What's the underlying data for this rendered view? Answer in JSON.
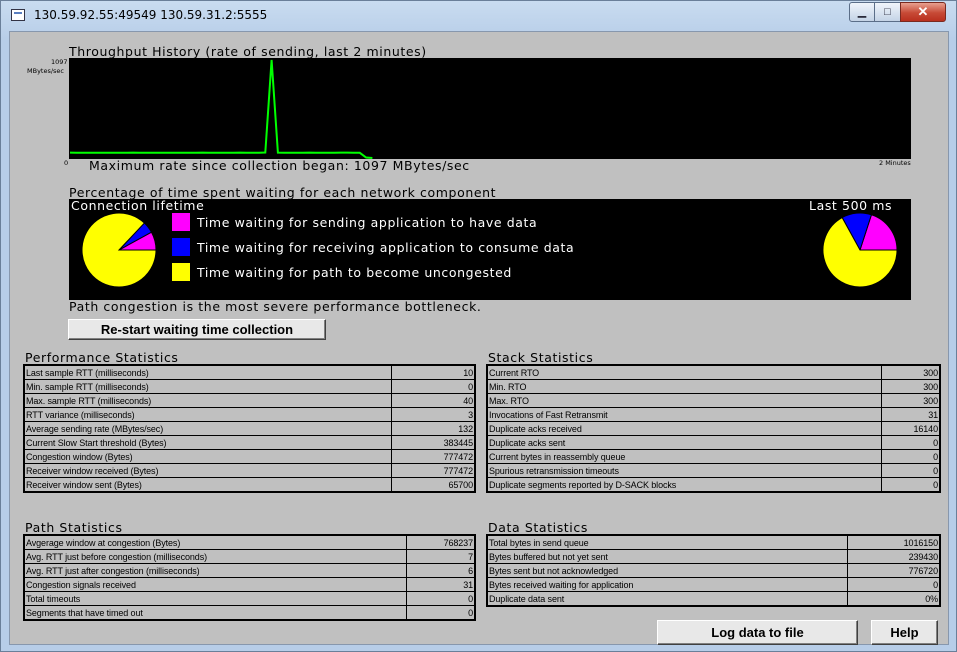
{
  "window": {
    "title": "130.59.92.55:49549 130.59.31.2:5555",
    "minimize_glyph": "▁",
    "maximize_glyph": "□",
    "close_glyph": "✕"
  },
  "throughput": {
    "heading": "Throughput History (rate of sending, last 2 minutes)",
    "y_max_label": "1097",
    "y_unit_label": "MBytes/sec",
    "x_start_label": "0",
    "x_end_label": "2 Minutes",
    "max_rate_text": "Maximum rate since collection began: 1097 MBytes/sec",
    "line_color": "#00ff00",
    "samples": [
      60,
      58,
      58,
      59,
      58,
      58,
      58,
      58,
      58,
      58,
      60,
      58,
      58,
      58,
      58,
      58,
      58,
      58,
      58,
      58,
      58,
      60,
      58,
      58,
      58,
      58,
      58,
      60,
      58,
      58,
      58,
      62,
      1097,
      60,
      58,
      58,
      58,
      58,
      60,
      58,
      58,
      58,
      58,
      60,
      60,
      58,
      58,
      6,
      0
    ]
  },
  "waiting": {
    "heading": "Percentage of time spent waiting for each network component",
    "lifetime_label": "Connection lifetime",
    "recent_label": "Last 500 ms",
    "legend": [
      {
        "label": "Time waiting for sending application to have data",
        "color": "#ff00ff"
      },
      {
        "label": "Time waiting for receiving application to consume data",
        "color": "#0000ff"
      },
      {
        "label": "Time waiting for path to become uncongested",
        "color": "#ffff00"
      }
    ],
    "lifetime_pie": [
      0.08,
      0.05,
      0.87
    ],
    "recent_pie": [
      0.2,
      0.13,
      0.67
    ],
    "bottleneck_text": "Path congestion is the most severe performance bottleneck.",
    "restart_label": "Re-start waiting time collection"
  },
  "performance": {
    "heading": "Performance Statistics",
    "rows": [
      {
        "label": "Last sample RTT (milliseconds)",
        "value": "10"
      },
      {
        "label": "Min. sample RTT (milliseconds)",
        "value": "0"
      },
      {
        "label": "Max. sample RTT (milliseconds)",
        "value": "40"
      },
      {
        "label": "RTT variance (milliseconds)",
        "value": "3"
      },
      {
        "label": "Average sending rate (MBytes/sec)",
        "value": "132"
      },
      {
        "label": "Current Slow Start threshold (Bytes)",
        "value": "383445"
      },
      {
        "label": "Congestion window (Bytes)",
        "value": "777472"
      },
      {
        "label": "Receiver window received (Bytes)",
        "value": "777472"
      },
      {
        "label": "Receiver window sent (Bytes)",
        "value": "65700"
      }
    ]
  },
  "stack": {
    "heading": "Stack Statistics",
    "rows": [
      {
        "label": "Current RTO",
        "value": "300"
      },
      {
        "label": "Min. RTO",
        "value": "300"
      },
      {
        "label": "Max. RTO",
        "value": "300"
      },
      {
        "label": "Invocations of Fast Retransmit",
        "value": "31"
      },
      {
        "label": "Duplicate acks received",
        "value": "16140"
      },
      {
        "label": "Duplicate acks sent",
        "value": "0"
      },
      {
        "label": "Current bytes in reassembly queue",
        "value": "0"
      },
      {
        "label": "Spurious retransmission timeouts",
        "value": "0"
      },
      {
        "label": "Duplicate segments reported by D-SACK blocks",
        "value": "0"
      }
    ]
  },
  "path": {
    "heading": "Path Statistics",
    "rows": [
      {
        "label": "Avgerage window at congestion (Bytes)",
        "value": "768237"
      },
      {
        "label": "Avg. RTT just before congestion (milliseconds)",
        "value": "7"
      },
      {
        "label": "Avg. RTT just after congestion (milliseconds)",
        "value": "6"
      },
      {
        "label": "Congestion signals received",
        "value": "31"
      },
      {
        "label": "Total timeouts",
        "value": "0"
      },
      {
        "label": "Segments that have timed out",
        "value": "0"
      }
    ]
  },
  "data_stats": {
    "heading": "Data Statistics",
    "rows": [
      {
        "label": "Total bytes in send queue",
        "value": "1016150"
      },
      {
        "label": "Bytes buffered but not yet sent",
        "value": "239430"
      },
      {
        "label": "Bytes sent but not acknowledged",
        "value": "776720"
      },
      {
        "label": "Bytes received waiting for application",
        "value": "0"
      },
      {
        "label": "Duplicate data sent",
        "value": "0%"
      }
    ]
  },
  "buttons": {
    "log_label": "Log data to file",
    "help_label": "Help"
  }
}
